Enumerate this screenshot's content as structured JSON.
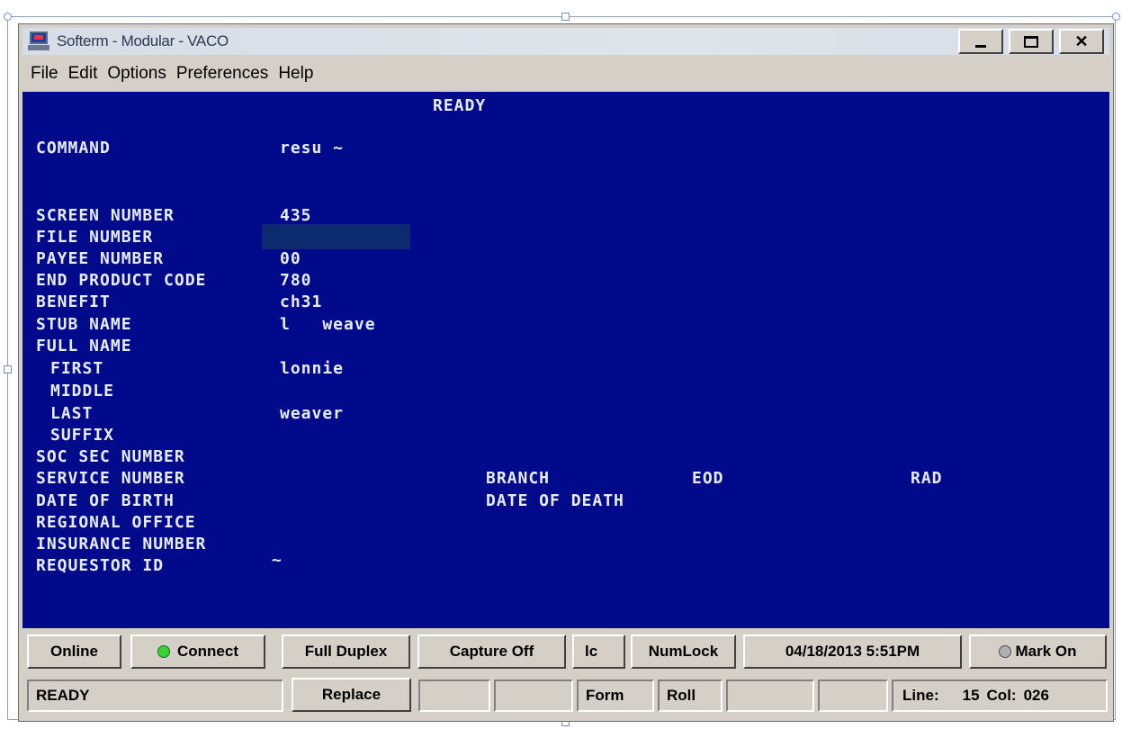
{
  "window": {
    "title": "Softerm - Modular - VACO"
  },
  "menu": [
    "File",
    "Edit",
    "Options",
    "Preferences",
    "Help"
  ],
  "terminal": {
    "status": "READY",
    "fields": {
      "command_label": "COMMAND",
      "command_value": "resu ~",
      "screen_number_label": "SCREEN NUMBER",
      "screen_number_value": "435",
      "file_number_label": "FILE NUMBER",
      "payee_number_label": "PAYEE NUMBER",
      "payee_number_value": "00",
      "end_product_code_label": "END PRODUCT CODE",
      "end_product_code_value": "780",
      "benefit_label": "BENEFIT",
      "benefit_value": "ch31",
      "stub_name_label": "STUB NAME",
      "stub_name_value": "l   weave",
      "full_name_label": "FULL NAME",
      "first_label": "FIRST",
      "first_value": "lonnie",
      "middle_label": "MIDDLE",
      "last_label": "LAST",
      "last_value": "weaver",
      "suffix_label": "SUFFIX",
      "soc_sec_label": "SOC SEC NUMBER",
      "service_number_label": "SERVICE NUMBER",
      "branch_label": "BRANCH",
      "eod_label": "EOD",
      "rad_label": "RAD",
      "dob_label": "DATE OF BIRTH",
      "dod_label": "DATE OF DEATH",
      "regional_office_label": "REGIONAL OFFICE",
      "insurance_number_label": "INSURANCE NUMBER",
      "requestor_id_label": "REQUESTOR ID",
      "requestor_id_value": "~"
    }
  },
  "buttons": {
    "online": "Online",
    "connect": "Connect",
    "duplex": "Full Duplex",
    "capture": "Capture Off",
    "case": "lc",
    "numlock": "NumLock",
    "datetime": "04/18/2013 5:51PM",
    "mark": "Mark On"
  },
  "status": {
    "state": "READY",
    "replace": "Replace",
    "form": "Form",
    "roll": "Roll",
    "line_label": "Line:",
    "line_value": "15",
    "col_label": "Col:",
    "col_value": "026"
  },
  "colors": {
    "terminal_bg": "#020a8c",
    "terminal_fg": "#e8ecff",
    "connect_led": "#3bd13b"
  }
}
